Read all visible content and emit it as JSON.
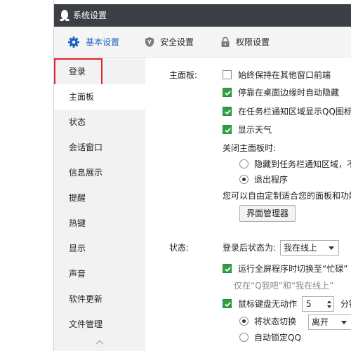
{
  "window": {
    "title": "系统设置"
  },
  "tabs": [
    {
      "label": "基本设置",
      "icon": "gear-icon",
      "active": true
    },
    {
      "label": "安全设置",
      "icon": "shield-icon"
    },
    {
      "label": "权限设置",
      "icon": "lock-icon"
    }
  ],
  "sidebar": {
    "items": [
      {
        "label": "登录"
      },
      {
        "label": "主面板",
        "active": true
      },
      {
        "label": "状态"
      },
      {
        "label": "会话窗口"
      },
      {
        "label": "信息展示"
      },
      {
        "label": "提醒"
      },
      {
        "label": "热键"
      },
      {
        "label": "显示"
      },
      {
        "label": "声音"
      },
      {
        "label": "软件更新"
      },
      {
        "label": "文件管理"
      }
    ]
  },
  "main_panel": {
    "label": "主面板:",
    "always_on_top": {
      "label": "始终保持在其他窗口前端",
      "checked": false
    },
    "auto_hide": {
      "label": "停靠在桌面边缘时自动隐藏",
      "checked": true
    },
    "tray_icon": {
      "label": "在任务栏通知区域显示QQ图标",
      "checked": true
    },
    "weather": {
      "label": "显示天气",
      "checked": true
    },
    "close_label": "关闭主面板时:",
    "close_hide": {
      "label": "隐藏到任务栏通知区域，不",
      "selected": false
    },
    "close_exit": {
      "label": "退出程序",
      "selected": true
    },
    "customize_text": "您可以自由定制适合您的面板和功能",
    "interface_manager_button": "界面管理器"
  },
  "status_section": {
    "label": "状态:",
    "after_login_label": "登录后状态为:",
    "after_login_value": "我在线上",
    "fullscreen_busy": {
      "label": "运行全屏程序时切换至“忙碌”",
      "checked": true
    },
    "fullscreen_note": "仅在“Q我吧”和“我在线上”",
    "idle": {
      "label": "鼠标键盘无动作",
      "checked": true,
      "minutes": "5",
      "unit": "分钟"
    },
    "idle_switch": {
      "label": "将状态切换",
      "selected": true,
      "value": "离开"
    },
    "idle_lock": {
      "label": "自动锁定QQ",
      "selected": false
    }
  },
  "colors": {
    "titlebar": "#3c3f45",
    "accent": "#1a63c6",
    "check_green": "#2ea043",
    "highlight": "#e4242b"
  }
}
